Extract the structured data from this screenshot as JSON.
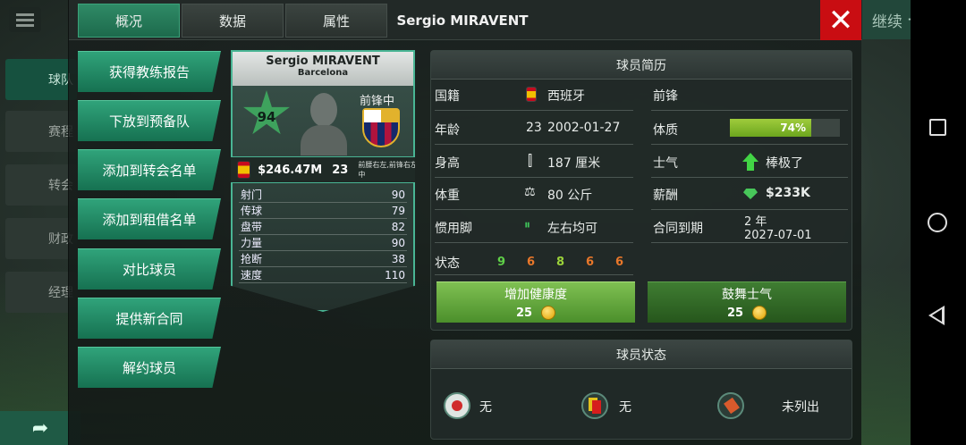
{
  "side_menu": {
    "items": [
      "球队",
      "赛程",
      "转会",
      "财政",
      "经理"
    ],
    "continue_label": "继续"
  },
  "tabs": [
    {
      "label": "概况",
      "active": true
    },
    {
      "label": "数据",
      "active": false
    },
    {
      "label": "属性",
      "active": false
    }
  ],
  "player_title": "Sergio MIRAVENT",
  "actions": [
    "获得教练报告",
    "下放到预备队",
    "添加到转会名单",
    "添加到租借名单",
    "对比球员",
    "提供新合同",
    "解约球员"
  ],
  "card": {
    "name": "Sergio MIRAVENT",
    "club": "Barcelona",
    "rating": "94",
    "position": "前锋中",
    "value": "$246.47M",
    "age": "23",
    "positions_small": "前腰右左,前锋右左中",
    "attributes": [
      {
        "label": "射门",
        "value": "90"
      },
      {
        "label": "传球",
        "value": "79"
      },
      {
        "label": "盘带",
        "value": "82"
      },
      {
        "label": "力量",
        "value": "90"
      },
      {
        "label": "抢断",
        "value": "38"
      },
      {
        "label": "速度",
        "value": "110"
      }
    ]
  },
  "profile": {
    "title": "球员简历",
    "nationality_label": "国籍",
    "nationality": "西班牙",
    "role": "前锋",
    "age_label": "年龄",
    "age": "23",
    "birthdate": "2002-01-27",
    "fitness_label": "体质",
    "fitness": "74%",
    "fitness_fraction": 0.74,
    "height_label": "身高",
    "height": "187 厘米",
    "morale_label": "士气",
    "morale": "棒极了",
    "weight_label": "体重",
    "weight": "80 公斤",
    "salary_label": "薪酬",
    "salary": "$233K",
    "foot_label": "惯用脚",
    "foot": "左右均可",
    "contract_label": "合同到期",
    "contract_years": "2 年",
    "contract_date": "2027-07-01",
    "form_label": "状态",
    "form": [
      {
        "value": "9",
        "color": "#5fd048"
      },
      {
        "value": "6",
        "color": "#e8772a"
      },
      {
        "value": "8",
        "color": "#9bd23a"
      },
      {
        "value": "6",
        "color": "#e8772a"
      },
      {
        "value": "6",
        "color": "#e8772a"
      }
    ]
  },
  "buttons": {
    "health_label": "增加健康度",
    "health_cost": "25",
    "morale_label": "鼓舞士气",
    "morale_cost": "25"
  },
  "status": {
    "title": "球员状态",
    "injury": "无",
    "cards": "无",
    "listing": "未列出"
  }
}
